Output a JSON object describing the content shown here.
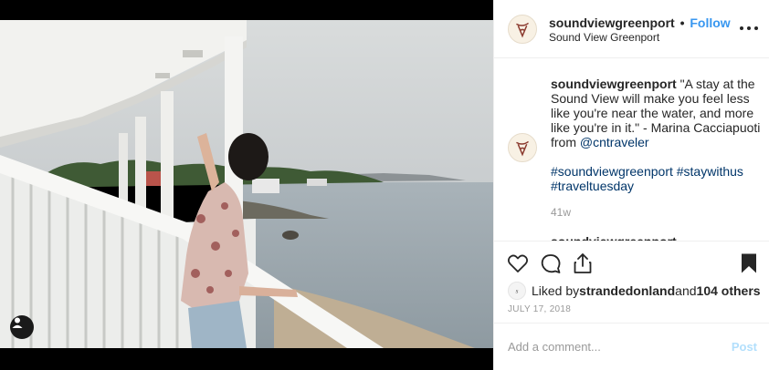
{
  "post": {
    "username": "soundviewgreenport",
    "dot": "•",
    "follow_label": "Follow",
    "location": "Sound View Greenport",
    "caption_user": "soundviewgreenport",
    "caption_text": " \"A stay at the Sound View will make you feel less like you're near the water, and more like you're in it.\" - Marina Cacciapuoti from ",
    "caption_mention": "@cntraveler",
    "hashtags": "#soundviewgreenport #staywithus #traveltuesday",
    "age": "41w",
    "next_comment_user": "soundviewgreenport"
  },
  "likes": {
    "prefix": "Liked by ",
    "liker": "strandedonland",
    "middle": " and ",
    "others": "104 others"
  },
  "date": "JULY 17, 2018",
  "comment_box": {
    "placeholder": "Add a comment...",
    "post_label": "Post"
  },
  "colors": {
    "accent": "#3897f0",
    "post_disabled": "#b2dffc",
    "text": "#262626",
    "muted": "#999999"
  },
  "icons": {
    "like": "heart-outline-icon",
    "comment": "speech-bubble-icon",
    "share": "share-upload-icon",
    "save": "bookmark-filled-icon",
    "tag": "user-tag-icon",
    "more": "more-horizontal-icon"
  }
}
